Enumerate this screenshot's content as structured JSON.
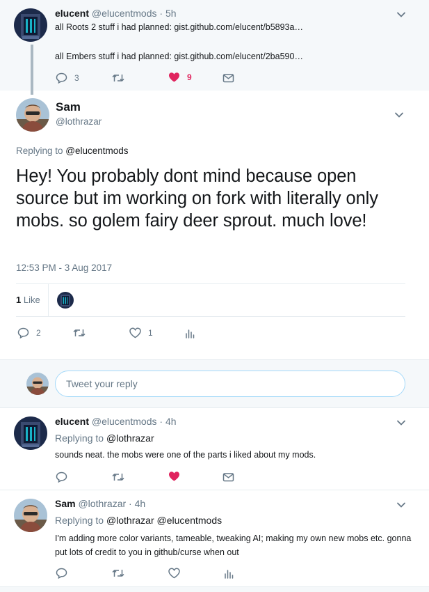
{
  "tweet_parent": {
    "name": "elucent",
    "handle": "@elucentmods",
    "sep_time": "· 5h",
    "line1_prefix": "all Roots 2 stuff i had planned: ",
    "line1_link": "gist.github.com/elucent/b5893a…",
    "line2_prefix": "all Embers stuff i had planned: ",
    "line2_link": "gist.github.com/elucent/2ba590…",
    "reply_count": "3",
    "like_count": "9"
  },
  "tweet_main": {
    "name": "Sam",
    "handle": "@lothrazar",
    "replying_prefix": "Replying to ",
    "replying_handle": "@elucentmods",
    "text": "Hey! You probably dont mind because open source but im working on fork with literally only mobs. so golem fairy deer sprout. much love!",
    "timestamp": "12:53 PM - 3 Aug 2017",
    "likes_count": "1",
    "likes_label": "Like",
    "reply_count": "2",
    "like_count": "1"
  },
  "reply_box": {
    "placeholder": "Tweet your reply"
  },
  "reply1": {
    "name": "elucent",
    "handle": "@elucentmods",
    "sep_time": "· 4h",
    "replying_prefix": "Replying to ",
    "replying_handle": "@lothrazar",
    "text": "sounds neat. the mobs were one of the parts i liked about my mods."
  },
  "reply2": {
    "name": "Sam",
    "handle": "@lothrazar",
    "sep_time": "· 4h",
    "replying_prefix": "Replying to ",
    "replying_handle1": "@lothrazar",
    "replying_handle2": "@elucentmods",
    "text": "I'm adding more color variants, tameable, tweaking AI; making my own new mobs etc. gonna put lots of credit to you in github/curse when out"
  },
  "colors": {
    "accent": "#1da1f2",
    "like": "#e0245e",
    "muted": "#657786",
    "band": "#f5f8fa"
  },
  "icons": [
    "reply-icon",
    "retweet-icon",
    "heart-icon",
    "message-icon",
    "analytics-icon",
    "chevron-down-icon"
  ]
}
